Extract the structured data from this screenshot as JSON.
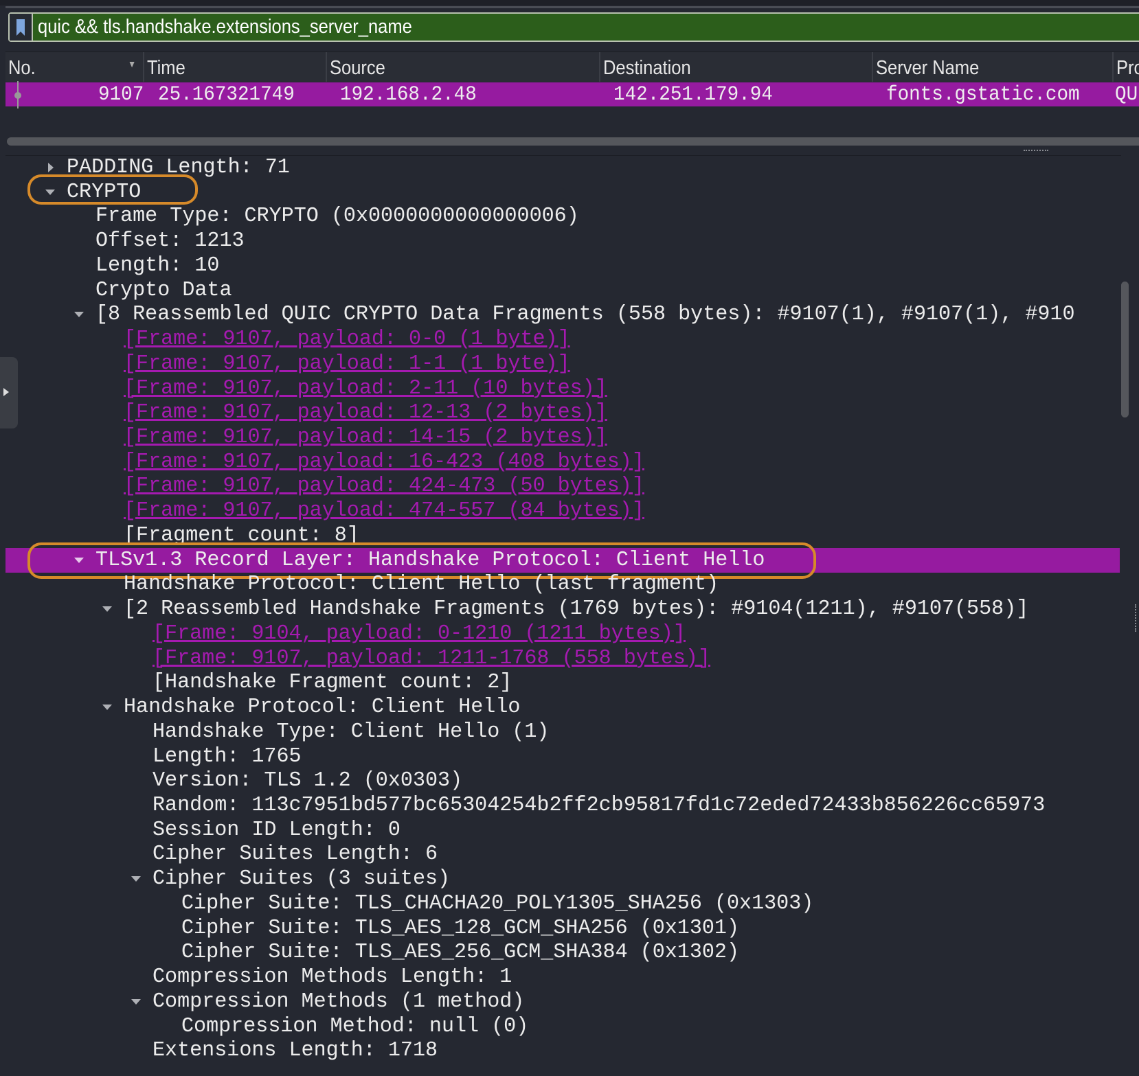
{
  "filter": {
    "value": "quic && tls.handshake.extensions_server_name",
    "bookmark_icon": "bookmark-icon",
    "valid_color": "#2c5e1b"
  },
  "packet_list": {
    "columns": [
      "No.",
      "Time",
      "Source",
      "Destination",
      "Server Name",
      "Pro"
    ],
    "rows": [
      {
        "no": "9107",
        "time": "25.167321749",
        "source": "192.168.2.48",
        "destination": "142.251.179.94",
        "server_name": "fonts.gstatic.com",
        "protocol": "QU"
      }
    ],
    "selected_color": "#961ba0"
  },
  "details": [
    {
      "text": "PADDING Length: 71",
      "level": 0,
      "arrow": "right"
    },
    {
      "text": "CRYPTO",
      "level": 0,
      "arrow": "down",
      "highlighted": true
    },
    {
      "text": "Frame Type: CRYPTO (0x0000000000000006)",
      "level": 1
    },
    {
      "text": "Offset: 1213",
      "level": 1
    },
    {
      "text": "Length: 10",
      "level": 1
    },
    {
      "text": "Crypto Data",
      "level": 1
    },
    {
      "text": "[8 Reassembled QUIC CRYPTO Data Fragments (558 bytes): #9107(1), #9107(1), #910",
      "level": 1,
      "arrow": "down"
    },
    {
      "text": "[Frame: 9107, payload: 0-0 (1 byte)]",
      "level": 2,
      "style": "link"
    },
    {
      "text": "[Frame: 9107, payload: 1-1 (1 byte)]",
      "level": 2,
      "style": "link"
    },
    {
      "text": "[Frame: 9107, payload: 2-11 (10 bytes)]",
      "level": 2,
      "style": "link"
    },
    {
      "text": "[Frame: 9107, payload: 12-13 (2 bytes)]",
      "level": 2,
      "style": "link"
    },
    {
      "text": "[Frame: 9107, payload: 14-15 (2 bytes)]",
      "level": 2,
      "style": "link"
    },
    {
      "text": "[Frame: 9107, payload: 16-423 (408 bytes)]",
      "level": 2,
      "style": "link"
    },
    {
      "text": "[Frame: 9107, payload: 424-473 (50 bytes)]",
      "level": 2,
      "style": "link"
    },
    {
      "text": "[Frame: 9107, payload: 474-557 (84 bytes)]",
      "level": 2,
      "style": "link"
    },
    {
      "text": "[Fragment count: 8]",
      "level": 2
    },
    {
      "text": "TLSv1.3 Record Layer: Handshake Protocol: Client Hello",
      "level": 1,
      "arrow": "down",
      "style": "selected",
      "highlighted": true
    },
    {
      "text": "Handshake Protocol: Client Hello (last fragment)",
      "level": 2
    },
    {
      "text": "[2 Reassembled Handshake Fragments (1769 bytes): #9104(1211), #9107(558)]",
      "level": 2,
      "arrow": "down"
    },
    {
      "text": "[Frame: 9104, payload: 0-1210 (1211 bytes)]",
      "level": 3,
      "style": "link"
    },
    {
      "text": "[Frame: 9107, payload: 1211-1768 (558 bytes)]",
      "level": 3,
      "style": "link"
    },
    {
      "text": "[Handshake Fragment count: 2]",
      "level": 3
    },
    {
      "text": "Handshake Protocol: Client Hello",
      "level": 2,
      "arrow": "down"
    },
    {
      "text": "Handshake Type: Client Hello (1)",
      "level": 3
    },
    {
      "text": "Length: 1765",
      "level": 3
    },
    {
      "text": "Version: TLS 1.2 (0x0303)",
      "level": 3
    },
    {
      "text": "Random: 113c7951bd577bc65304254b2ff2cb95817fd1c72eded72433b856226cc65973",
      "level": 3
    },
    {
      "text": "Session ID Length: 0",
      "level": 3
    },
    {
      "text": "Cipher Suites Length: 6",
      "level": 3
    },
    {
      "text": "Cipher Suites (3 suites)",
      "level": 3,
      "arrow": "down"
    },
    {
      "text": "Cipher Suite: TLS_CHACHA20_POLY1305_SHA256 (0x1303)",
      "level": 4
    },
    {
      "text": "Cipher Suite: TLS_AES_128_GCM_SHA256 (0x1301)",
      "level": 4
    },
    {
      "text": "Cipher Suite: TLS_AES_256_GCM_SHA384 (0x1302)",
      "level": 4
    },
    {
      "text": "Compression Methods Length: 1",
      "level": 3
    },
    {
      "text": "Compression Methods (1 method)",
      "level": 3,
      "arrow": "down"
    },
    {
      "text": "Compression Method: null (0)",
      "level": 4
    },
    {
      "text": "Extensions Length: 1718",
      "level": 3
    }
  ],
  "colors": {
    "link": "#a51ab0",
    "highlight_ring": "#d68a2a",
    "background": "#252831"
  }
}
